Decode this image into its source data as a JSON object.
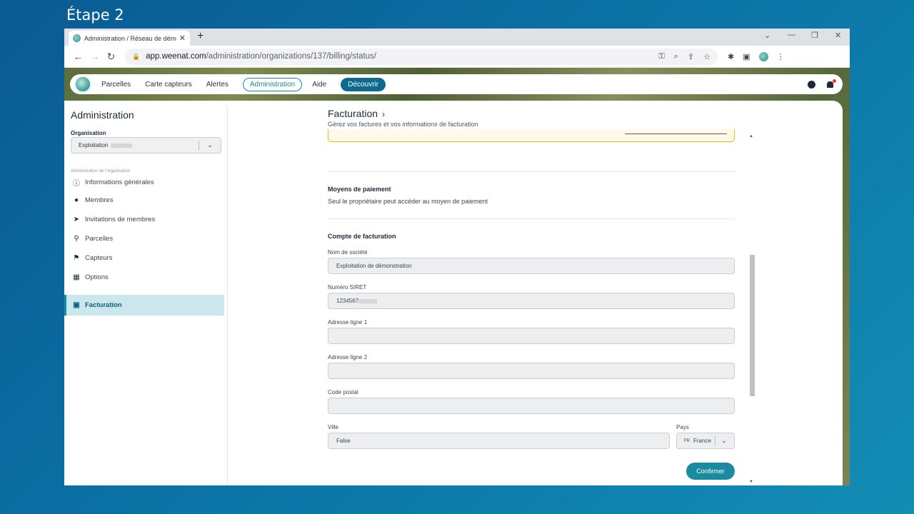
{
  "step_title": "Étape 2",
  "browser": {
    "tab_title": "Administration / Réseau de démo",
    "tab_close": "✕",
    "new_tab": "+",
    "url_host": "app.weenat.com",
    "url_path": "/administration/organizations/137/billing/status/"
  },
  "topnav": {
    "items": [
      "Parcelles",
      "Carte capteurs",
      "Alertes"
    ],
    "active": "Administration",
    "aide": "Aide",
    "decouvrir": "Découvrir"
  },
  "sidebar": {
    "title": "Administration",
    "org_label": "Organisation",
    "org_value": "Exploitation",
    "section_label": "Administration de l'organisation",
    "items": [
      {
        "label": "Informations générales",
        "icon": "info-icon"
      },
      {
        "label": "Membres",
        "icon": "person-icon"
      },
      {
        "label": "Invitations de membres",
        "icon": "send-icon"
      },
      {
        "label": "Parcelles",
        "icon": "plot-icon"
      },
      {
        "label": "Capteurs",
        "icon": "sensor-icon"
      },
      {
        "label": "Options",
        "icon": "grid-icon"
      }
    ],
    "active_item": "Facturation"
  },
  "main": {
    "title": "Facturation",
    "subtitle": "Gérez vos factures et vos informations de facturation",
    "payment_title": "Moyens de paiement",
    "payment_text": "Seul le propriétaire peut accéder au moyen de paiement",
    "billing_title": "Compte de facturation",
    "fields": {
      "company_label": "Nom de société",
      "company_value": "Exploitation de démonstration",
      "siret_label": "Numéro SIRET",
      "siret_value": "1234567",
      "addr1_label": "Adresse ligne 1",
      "addr1_value": "",
      "addr2_label": "Adresse ligne 2",
      "addr2_value": "",
      "postal_label": "Code postal",
      "postal_value": "",
      "city_label": "Ville",
      "city_value": "False",
      "country_label": "Pays",
      "country_code": "FR",
      "country_value": "France"
    },
    "confirm_label": "Confirmer"
  },
  "colors": {
    "accent": "#1a8aa0",
    "active_bg": "#cbe7ee",
    "warning_border": "#f0b429",
    "background": "#0b74a6"
  }
}
